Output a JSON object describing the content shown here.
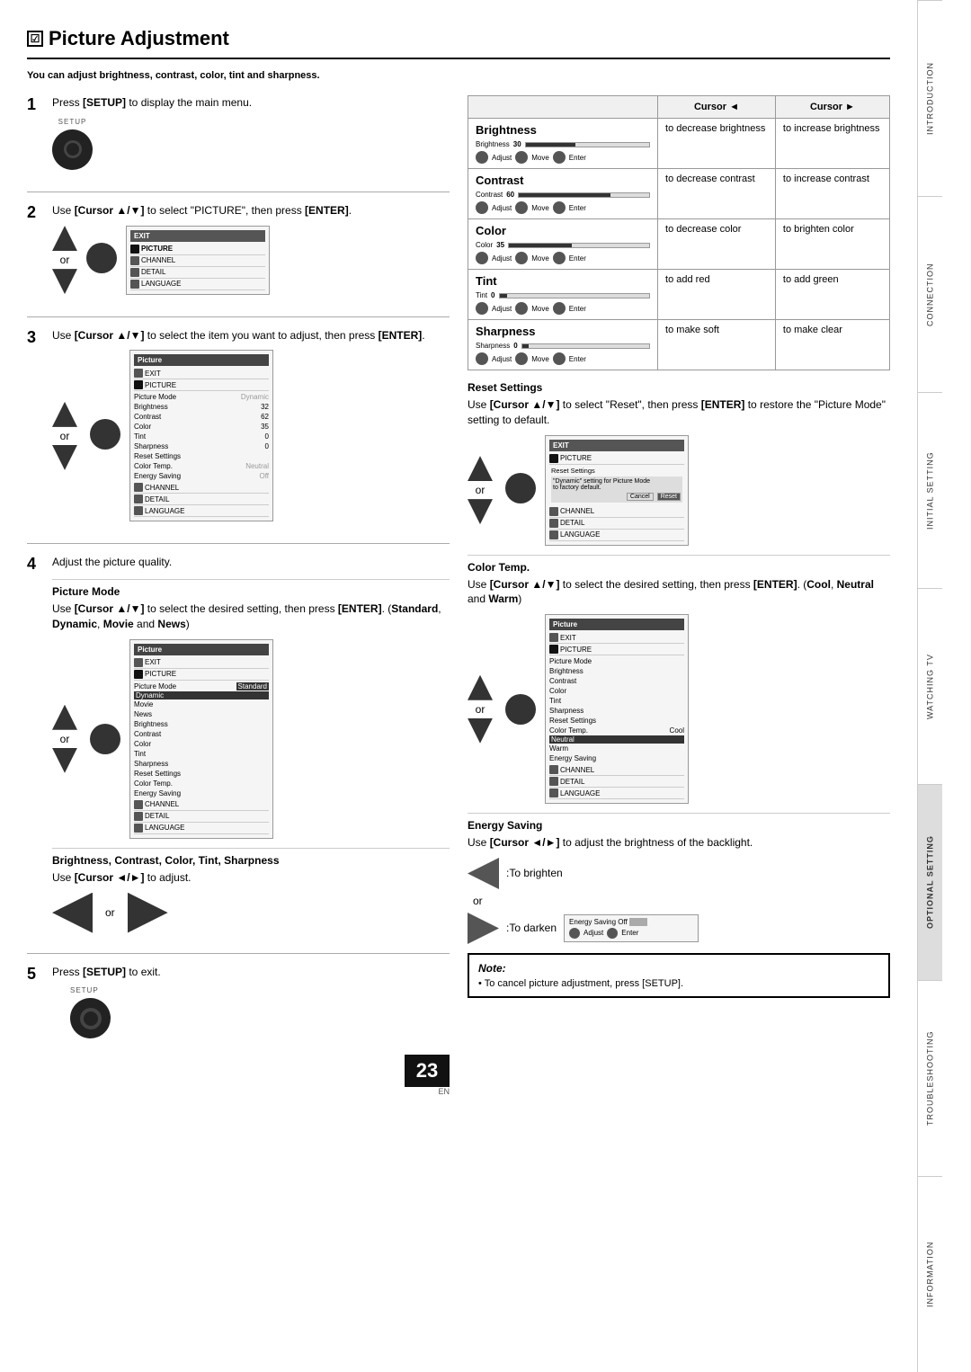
{
  "page": {
    "title": "Picture Adjustment",
    "checkbox_symbol": "☑",
    "subtitle": "You can adjust brightness, contrast, color, tint and sharpness.",
    "step1": {
      "number": "1",
      "text": "Press [SETUP] to display the main menu.",
      "setup_label": "SETUP"
    },
    "step2": {
      "number": "2",
      "text_before": "Use [Cursor ▲/▼] to select \"PICTURE\", then press",
      "text_enter": "[ENTER].",
      "or": "or"
    },
    "step3": {
      "number": "3",
      "text": "Use [Cursor ▲/▼] to select the item you want to adjust, then press [ENTER].",
      "or": "or"
    },
    "step4": {
      "number": "4",
      "text_main": "Adjust the picture quality.",
      "picture_mode_title": "Picture Mode",
      "picture_mode_text": "Use [Cursor ▲/▼] to select the desired setting, then press [ENTER]. (Standard, Dynamic, Movie and News)",
      "or": "or",
      "brightness_contrast_title": "Brightness, Contrast, Color, Tint, Sharpness",
      "brightness_contrast_text": "Use [Cursor ◄/►] to adjust.",
      "or2": "or"
    },
    "step5": {
      "number": "5",
      "text": "Press [SETUP] to exit.",
      "setup_label": "SETUP"
    },
    "right_table": {
      "header_cursor_left": "Cursor ◄",
      "header_cursor_right": "Cursor ►",
      "sections": [
        {
          "name": "Brightness",
          "slider_value": "30",
          "left_action": "to decrease brightness",
          "right_action": "to increase brightness"
        },
        {
          "name": "Contrast",
          "slider_value": "60",
          "left_action": "to decrease contrast",
          "right_action": "to increase contrast"
        },
        {
          "name": "Color",
          "slider_value": "35",
          "left_action": "to decrease color",
          "right_action": "to brighten color"
        },
        {
          "name": "Tint",
          "slider_value": "0",
          "left_action": "to add red",
          "right_action": "to add green"
        },
        {
          "name": "Sharpness",
          "slider_value": "0",
          "left_action": "to make soft",
          "right_action": "to make clear"
        }
      ]
    },
    "reset_settings": {
      "title": "Reset Settings",
      "text": "Use [Cursor ▲/▼] to select \"Reset\", then press [ENTER] to restore the \"Picture Mode\" setting to default.",
      "or": "or"
    },
    "color_temp": {
      "title": "Color Temp.",
      "text": "Use [Cursor ▲/▼] to select the desired setting, then press [ENTER]. (Cool, Neutral and Warm)",
      "or": "or"
    },
    "energy_saving": {
      "title": "Energy Saving",
      "text": "Use [Cursor ◄/►] to adjust the brightness of the backlight.",
      "to_brighten": ":To brighten",
      "to_darken": ":To darken",
      "or": "or"
    },
    "note": {
      "title": "Note:",
      "bullet": "• To cancel picture adjustment, press [SETUP]."
    },
    "page_number": "23",
    "page_number_sub": "EN",
    "sidebar_sections": [
      "INTRODUCTION",
      "CONNECTION",
      "INITIAL SETTING",
      "WATCHING TV",
      "OPTIONAL SETTING",
      "TROUBLESHOOTING",
      "INFORMATION"
    ]
  }
}
